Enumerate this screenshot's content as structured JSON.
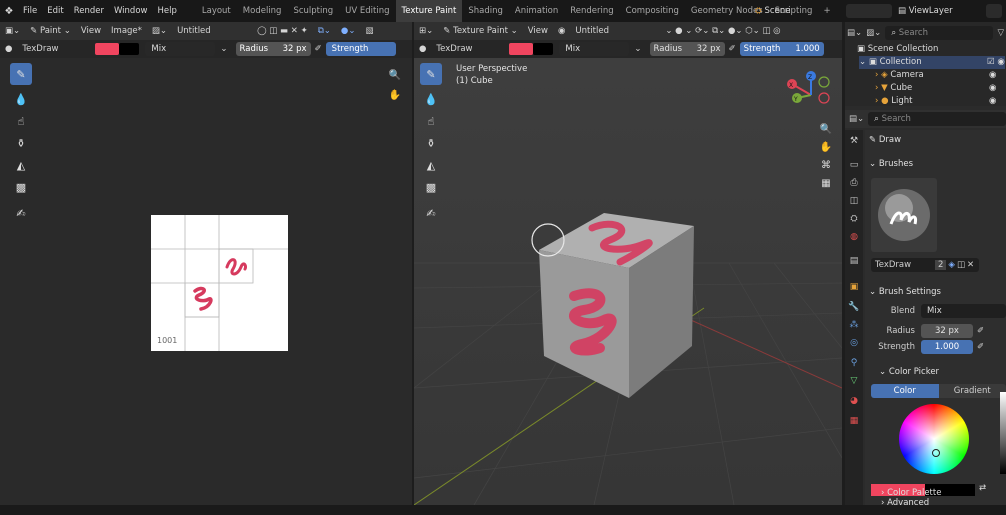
{
  "topbar": {
    "menus": [
      "File",
      "Edit",
      "Render",
      "Window",
      "Help"
    ],
    "workspaces": [
      "Layout",
      "Modeling",
      "Sculpting",
      "UV Editing",
      "Texture Paint",
      "Shading",
      "Animation",
      "Rendering",
      "Compositing",
      "Geometry Nodes",
      "Scripting"
    ],
    "active_workspace": "Texture Paint",
    "plus": "+",
    "scene": "Scene",
    "view_layer": "ViewLayer"
  },
  "image_editor": {
    "mode": "Paint",
    "menus": [
      "View",
      "Image*"
    ],
    "image_name": "Untitled",
    "brush": "TexDraw",
    "blend": "Mix",
    "radius_label": "Radius",
    "radius_value": "32 px",
    "strength_label": "Strength",
    "tile_label": "1001"
  },
  "viewport": {
    "mode": "Texture Paint",
    "menus": [
      "View"
    ],
    "image_name": "Untitled",
    "brush": "TexDraw",
    "blend": "Mix",
    "radius_label": "Radius",
    "radius_value": "32 px",
    "strength_label": "Strength",
    "strength_value": "1.000",
    "perspective": "User Perspective",
    "object": "(1) Cube",
    "gizmo": {
      "x": "X",
      "y": "Y",
      "z": "Z"
    }
  },
  "outliner": {
    "search_placeholder": "Search",
    "root": "Scene Collection",
    "collection": "Collection",
    "items": [
      "Camera",
      "Cube",
      "Light"
    ]
  },
  "properties": {
    "search_placeholder": "Search",
    "tool_name": "Draw",
    "brushes_title": "Brushes",
    "brush_name": "TexDraw",
    "brush_users": "2",
    "brush_settings_title": "Brush Settings",
    "blend_label": "Blend",
    "blend_value": "Mix",
    "radius_label": "Radius",
    "radius_value": "32 px",
    "strength_label": "Strength",
    "strength_value": "1.000",
    "color_picker_title": "Color Picker",
    "color_tab": "Color",
    "gradient_tab": "Gradient",
    "color_palette": "Color Palette",
    "advanced": "Advanced"
  },
  "colors": {
    "accent": "#4772b3",
    "brush_color": "#f0455f",
    "paint": "#d63a5e"
  }
}
